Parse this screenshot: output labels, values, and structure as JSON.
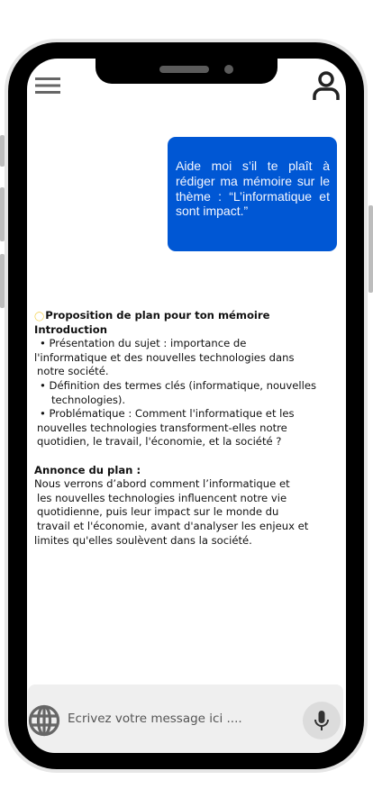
{
  "chat": {
    "user_message": "Aide moi s’il te plaît à rédiger ma mémoire sur le thème : “L’informatique et sont impact.”",
    "response": {
      "title": "Proposition de plan pour ton mémoire",
      "lines": [
        "Introduction",
        " • Présentation du sujet : importance de",
        "l'informatique et des nouvelles technologies dans",
        "notre société.",
        " • Définition des termes clés (informatique, nouvelles",
        "technologies).",
        " • Problématique : Comment l'informatique et les",
        "nouvelles technologies transforment-elles notre",
        "quotidien, le travail, l'économie, et la société ?",
        "Annonce du plan :",
        "Nous verrons d’abord comment l’informatique et",
        "les nouvelles technologies influencent notre vie",
        "quotidienne, puis leur impact sur le monde du",
        "travail et l'économie, avant d'analyser les enjeux et",
        "limites qu'elles soulèvent dans la société."
      ]
    }
  },
  "input": {
    "placeholder": "Ecrivez votre message ici ...."
  },
  "icons": {
    "menu": "hamburger-icon",
    "profile": "user-icon",
    "globe": "globe-icon",
    "mic": "microphone-icon",
    "title": "lightbulb-icon"
  },
  "colors": {
    "bubble": "#0057d4",
    "input_bg": "#efefef"
  }
}
